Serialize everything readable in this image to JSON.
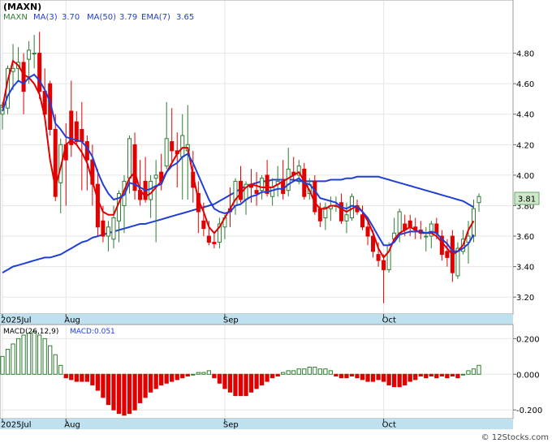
{
  "chart_data": [
    {
      "type": "candlestick",
      "title": "(MAXN)",
      "legend": {
        "ticker": "MAXN",
        "ma3_label": "MA(3)",
        "ma3_value": "3.70",
        "ma50_label": "MA(50)",
        "ma50_value": "3.79",
        "ema7_label": "EMA(7)",
        "ema7_value": "3.65"
      },
      "last_price_label": "3.81",
      "ylim": [
        3.1,
        5.0
      ],
      "y_ticks": [
        "4.80",
        "4.60",
        "4.40",
        "4.20",
        "4.00",
        "3.80",
        "3.60",
        "3.40",
        "3.20"
      ],
      "x_labels": [
        {
          "label": "2025Jul",
          "index": 0
        },
        {
          "label": "Aug",
          "index": 12
        },
        {
          "label": "Sep",
          "index": 42
        },
        {
          "label": "Oct",
          "index": 72
        }
      ],
      "candles": [
        [
          4.4,
          4.48,
          4.3,
          4.46
        ],
        [
          4.44,
          4.72,
          4.4,
          4.7
        ],
        [
          4.68,
          4.86,
          4.56,
          4.7
        ],
        [
          4.7,
          4.84,
          4.62,
          4.74
        ],
        [
          4.74,
          4.8,
          4.4,
          4.55
        ],
        [
          4.76,
          4.88,
          4.6,
          4.82
        ],
        [
          4.8,
          4.92,
          4.7,
          4.8
        ],
        [
          4.8,
          4.94,
          4.5,
          4.55
        ],
        [
          4.55,
          4.7,
          4.38,
          4.4
        ],
        [
          4.6,
          4.62,
          4.26,
          4.3
        ],
        [
          4.3,
          4.4,
          3.83,
          3.86
        ],
        [
          3.95,
          4.24,
          3.75,
          4.2
        ],
        [
          4.2,
          4.34,
          3.8,
          4.1
        ],
        [
          4.42,
          4.62,
          4.12,
          4.2
        ],
        [
          4.35,
          4.42,
          4.2,
          4.22
        ],
        [
          4.3,
          4.48,
          3.9,
          4.22
        ],
        [
          4.22,
          4.26,
          3.9,
          4.1
        ],
        [
          4.1,
          4.2,
          3.8,
          3.94
        ],
        [
          3.94,
          4.04,
          3.6,
          3.66
        ],
        [
          3.7,
          3.8,
          3.56,
          3.6
        ],
        [
          3.6,
          3.7,
          3.5,
          3.66
        ],
        [
          3.58,
          3.8,
          3.52,
          3.72
        ],
        [
          3.7,
          3.9,
          3.56,
          3.88
        ],
        [
          3.8,
          4.0,
          3.62,
          3.96
        ],
        [
          3.98,
          4.26,
          3.88,
          4.24
        ],
        [
          4.2,
          4.28,
          3.84,
          3.9
        ],
        [
          3.9,
          4.1,
          3.8,
          3.84
        ],
        [
          3.96,
          4.12,
          3.82,
          3.84
        ],
        [
          3.84,
          4.0,
          3.72,
          3.96
        ],
        [
          3.98,
          4.1,
          3.56,
          4.0
        ],
        [
          4.02,
          4.14,
          3.9,
          3.96
        ],
        [
          4.06,
          4.48,
          4.04,
          4.24
        ],
        [
          4.22,
          4.44,
          4.08,
          4.16
        ],
        [
          4.16,
          4.28,
          3.92,
          4.14
        ],
        [
          4.12,
          4.4,
          3.84,
          4.26
        ],
        [
          4.16,
          4.46,
          3.84,
          4.2
        ],
        [
          4.02,
          4.16,
          3.82,
          3.92
        ],
        [
          3.88,
          3.96,
          3.62,
          3.76
        ],
        [
          3.7,
          3.82,
          3.6,
          3.65
        ],
        [
          3.6,
          3.7,
          3.54,
          3.56
        ],
        [
          3.56,
          3.62,
          3.52,
          3.55
        ],
        [
          3.56,
          3.72,
          3.52,
          3.68
        ],
        [
          3.66,
          3.74,
          3.58,
          3.72
        ],
        [
          3.78,
          3.92,
          3.66,
          3.76
        ],
        [
          3.8,
          3.98,
          3.74,
          3.96
        ],
        [
          3.96,
          4.06,
          3.82,
          3.84
        ],
        [
          3.84,
          3.96,
          3.74,
          3.94
        ],
        [
          3.94,
          4.04,
          3.82,
          3.92
        ],
        [
          3.9,
          4.02,
          3.8,
          3.88
        ],
        [
          3.9,
          4.0,
          3.84,
          3.98
        ],
        [
          4.0,
          4.1,
          3.86,
          3.88
        ],
        [
          3.86,
          3.98,
          3.8,
          3.92
        ],
        [
          3.94,
          4.06,
          3.86,
          3.96
        ],
        [
          3.96,
          4.1,
          3.84,
          3.88
        ],
        [
          3.9,
          4.18,
          3.86,
          4.04
        ],
        [
          4.02,
          4.12,
          3.96,
          4.0
        ],
        [
          4.0,
          4.1,
          3.94,
          4.06
        ],
        [
          4.04,
          4.08,
          3.84,
          3.86
        ],
        [
          3.88,
          3.98,
          3.84,
          3.94
        ],
        [
          3.96,
          4.0,
          3.74,
          3.76
        ],
        [
          3.78,
          3.82,
          3.66,
          3.7
        ],
        [
          3.72,
          3.82,
          3.64,
          3.79
        ],
        [
          3.78,
          3.86,
          3.7,
          3.8
        ],
        [
          3.8,
          3.86,
          3.76,
          3.8
        ],
        [
          3.82,
          3.88,
          3.68,
          3.7
        ],
        [
          3.7,
          3.82,
          3.62,
          3.74
        ],
        [
          3.72,
          3.88,
          3.7,
          3.86
        ],
        [
          3.8,
          3.84,
          3.74,
          3.76
        ],
        [
          3.74,
          3.8,
          3.64,
          3.66
        ],
        [
          3.66,
          3.7,
          3.54,
          3.6
        ],
        [
          3.6,
          3.64,
          3.46,
          3.5
        ],
        [
          3.48,
          3.56,
          3.4,
          3.44
        ],
        [
          3.44,
          3.48,
          3.16,
          3.38
        ],
        [
          3.38,
          3.56,
          3.36,
          3.54
        ],
        [
          3.58,
          3.72,
          3.56,
          3.62
        ],
        [
          3.62,
          3.78,
          3.56,
          3.76
        ],
        [
          3.68,
          3.74,
          3.6,
          3.64
        ],
        [
          3.7,
          3.74,
          3.6,
          3.66
        ],
        [
          3.66,
          3.72,
          3.58,
          3.64
        ],
        [
          3.64,
          3.7,
          3.58,
          3.62
        ],
        [
          3.6,
          3.66,
          3.5,
          3.6
        ],
        [
          3.6,
          3.7,
          3.52,
          3.68
        ],
        [
          3.68,
          3.72,
          3.58,
          3.62
        ],
        [
          3.6,
          3.64,
          3.44,
          3.48
        ],
        [
          3.5,
          3.58,
          3.4,
          3.46
        ],
        [
          3.6,
          3.64,
          3.3,
          3.36
        ],
        [
          3.34,
          3.56,
          3.32,
          3.52
        ],
        [
          3.5,
          3.64,
          3.48,
          3.58
        ],
        [
          3.56,
          3.7,
          3.42,
          3.6
        ],
        [
          3.6,
          3.84,
          3.56,
          3.78
        ],
        [
          3.82,
          3.88,
          3.76,
          3.86
        ]
      ],
      "ma3": [
        4.44,
        4.62,
        4.75,
        4.72,
        4.66,
        4.64,
        4.6,
        4.53,
        4.38,
        4.1,
        3.92,
        4.05,
        4.2,
        4.23,
        4.2,
        4.15,
        4.08,
        3.96,
        3.84,
        3.76,
        3.74,
        3.74,
        3.82,
        3.9,
        3.98,
        4.02,
        3.9,
        3.86,
        3.88,
        3.92,
        3.96,
        4.02,
        4.08,
        4.14,
        4.18,
        4.18,
        4.0,
        3.84,
        3.76,
        3.66,
        3.62,
        3.66,
        3.72,
        3.78,
        3.84,
        3.88,
        3.92,
        3.94,
        3.93,
        3.92,
        3.92,
        3.92,
        3.94,
        3.96,
        3.98,
        4.0,
        4.02,
        3.96,
        3.9,
        3.82,
        3.78,
        3.78,
        3.8,
        3.8,
        3.78,
        3.76,
        3.78,
        3.8,
        3.76,
        3.7,
        3.62,
        3.52,
        3.46,
        3.5,
        3.58,
        3.62,
        3.64,
        3.66,
        3.64,
        3.62,
        3.62,
        3.62,
        3.6,
        3.56,
        3.52,
        3.48,
        3.5,
        3.54,
        3.64,
        3.7
      ],
      "ema7": [
        4.42,
        4.52,
        4.58,
        4.62,
        4.6,
        4.64,
        4.66,
        4.62,
        4.56,
        4.48,
        4.34,
        4.3,
        4.25,
        4.24,
        4.23,
        4.22,
        4.18,
        4.12,
        4.02,
        3.94,
        3.88,
        3.84,
        3.85,
        3.87,
        3.95,
        3.94,
        3.92,
        3.9,
        3.91,
        3.93,
        3.94,
        4.02,
        4.06,
        4.08,
        4.12,
        4.14,
        4.08,
        4.0,
        3.92,
        3.84,
        3.78,
        3.76,
        3.75,
        3.76,
        3.8,
        3.81,
        3.84,
        3.86,
        3.87,
        3.89,
        3.89,
        3.9,
        3.91,
        3.91,
        3.94,
        3.96,
        3.98,
        3.95,
        3.94,
        3.9,
        3.85,
        3.84,
        3.83,
        3.82,
        3.79,
        3.78,
        3.8,
        3.79,
        3.76,
        3.72,
        3.66,
        3.6,
        3.54,
        3.54,
        3.56,
        3.61,
        3.62,
        3.63,
        3.63,
        3.63,
        3.62,
        3.63,
        3.62,
        3.58,
        3.55,
        3.5,
        3.5,
        3.52,
        3.55,
        3.61
      ],
      "ma50": [
        3.36,
        3.38,
        3.4,
        3.41,
        3.42,
        3.43,
        3.44,
        3.45,
        3.46,
        3.46,
        3.47,
        3.48,
        3.5,
        3.52,
        3.54,
        3.56,
        3.57,
        3.59,
        3.6,
        3.61,
        3.62,
        3.63,
        3.64,
        3.65,
        3.66,
        3.67,
        3.68,
        3.68,
        3.69,
        3.7,
        3.71,
        3.72,
        3.73,
        3.74,
        3.75,
        3.76,
        3.77,
        3.78,
        3.79,
        3.8,
        3.81,
        3.83,
        3.85,
        3.87,
        3.89,
        3.91,
        3.93,
        3.94,
        3.95,
        3.96,
        3.96,
        3.97,
        3.97,
        3.97,
        3.97,
        3.97,
        3.96,
        3.96,
        3.96,
        3.96,
        3.96,
        3.96,
        3.97,
        3.97,
        3.97,
        3.98,
        3.98,
        3.99,
        3.99,
        3.99,
        3.99,
        3.99,
        3.98,
        3.97,
        3.96,
        3.95,
        3.94,
        3.93,
        3.92,
        3.91,
        3.9,
        3.89,
        3.88,
        3.87,
        3.86,
        3.85,
        3.84,
        3.83,
        3.81,
        3.79
      ]
    },
    {
      "type": "bar",
      "legend": {
        "title": "MACD(26,12,9)",
        "value_label": "MACD:0.051"
      },
      "ylim": [
        -0.24,
        0.27
      ],
      "y_ticks": [
        "0.200",
        "0.000",
        "-0.200"
      ],
      "values": [
        0.1,
        0.14,
        0.17,
        0.2,
        0.22,
        0.23,
        0.24,
        0.22,
        0.2,
        0.16,
        0.11,
        0.05,
        -0.02,
        -0.03,
        -0.04,
        -0.04,
        -0.04,
        -0.06,
        -0.09,
        -0.13,
        -0.17,
        -0.2,
        -0.22,
        -0.23,
        -0.22,
        -0.2,
        -0.16,
        -0.13,
        -0.1,
        -0.08,
        -0.06,
        -0.05,
        -0.04,
        -0.03,
        -0.02,
        -0.01,
        0.0,
        0.01,
        0.01,
        0.02,
        -0.02,
        -0.05,
        -0.08,
        -0.1,
        -0.12,
        -0.12,
        -0.12,
        -0.1,
        -0.08,
        -0.06,
        -0.04,
        -0.02,
        -0.01,
        0.01,
        0.02,
        0.02,
        0.03,
        0.03,
        0.04,
        0.04,
        0.03,
        0.03,
        0.02,
        -0.01,
        -0.02,
        -0.02,
        -0.01,
        -0.02,
        -0.03,
        -0.04,
        -0.04,
        -0.03,
        -0.04,
        -0.06,
        -0.07,
        -0.07,
        -0.06,
        -0.04,
        -0.03,
        -0.01,
        -0.02,
        -0.01,
        -0.02,
        -0.01,
        -0.02,
        -0.01,
        -0.02,
        0.0,
        0.02,
        0.03,
        0.05
      ]
    }
  ],
  "colors": {
    "up_candle": "#2e7d32",
    "down_candle": "#e00000",
    "ma3": "#e00000",
    "ema7": "#1f3fd6",
    "ma50": "#1f3fd6",
    "axis_bar": "#bfe0ef",
    "last_price_bg": "#cfe8c9"
  },
  "watermark": "© 12Stocks.com"
}
